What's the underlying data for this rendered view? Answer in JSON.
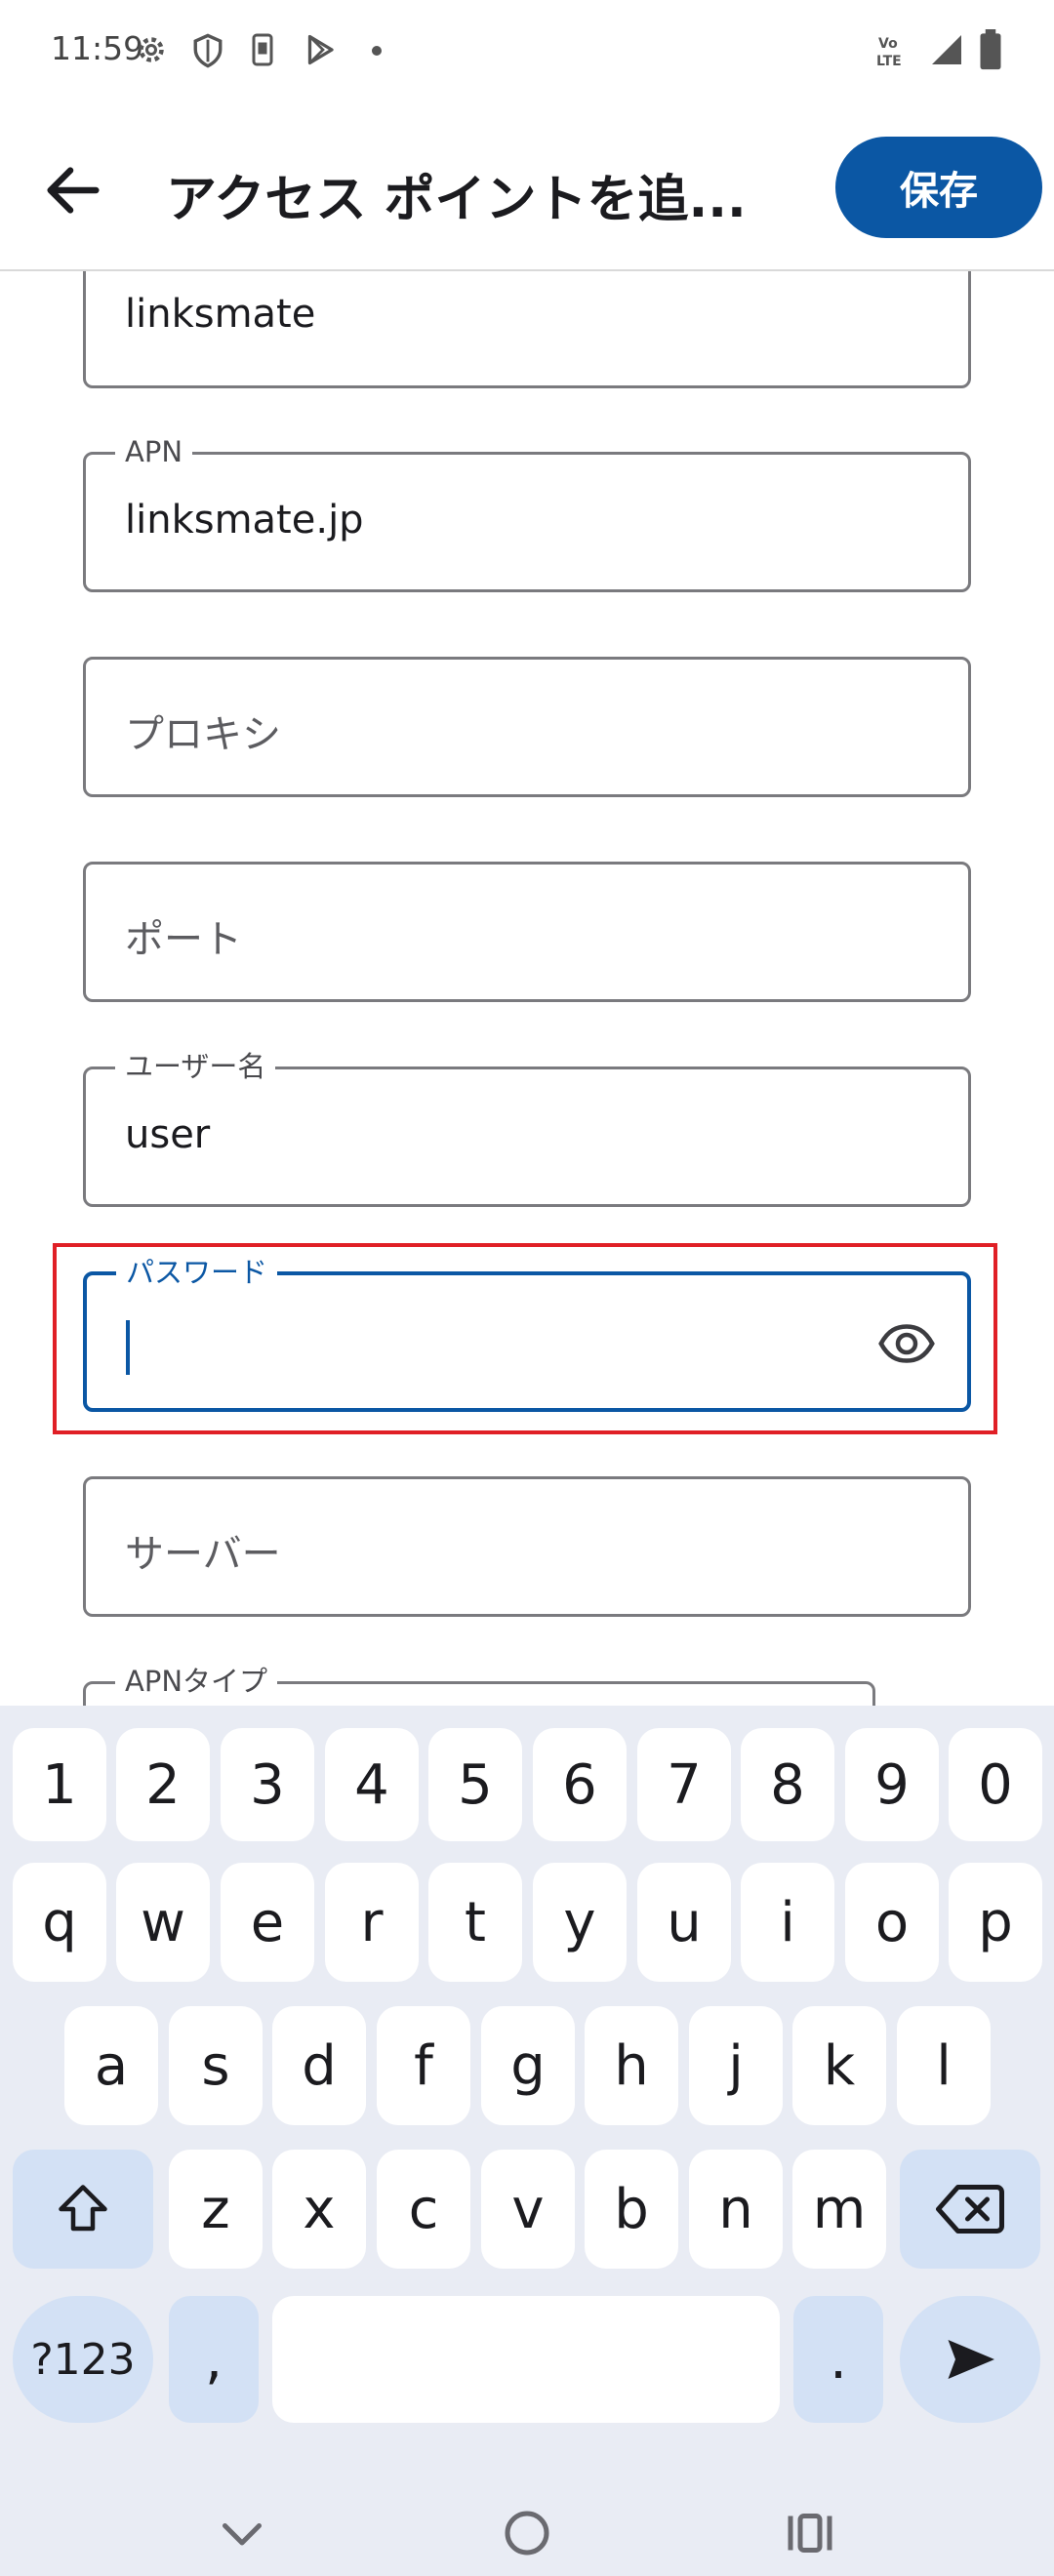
{
  "status_bar": {
    "time": "11:59",
    "icons": [
      "gear-icon",
      "shield-icon",
      "sim-icon",
      "play-store-icon",
      "dot-icon",
      "volte-icon",
      "signal-icon",
      "battery-icon"
    ],
    "volte_text": "Vo LTE"
  },
  "app_bar": {
    "title": "アクセス ポイントを追...",
    "save_label": "保存"
  },
  "form": {
    "name_value": "linksmate",
    "apn_label": "APN",
    "apn_value": "linksmate.jp",
    "proxy_placeholder": "プロキシ",
    "port_placeholder": "ポート",
    "username_label": "ユーザー名",
    "username_value": "user",
    "password_label": "パスワード",
    "password_value": "",
    "server_placeholder": "サーバー",
    "apn_type_label": "APNタイプ"
  },
  "keyboard": {
    "row_numbers": [
      "1",
      "2",
      "3",
      "4",
      "5",
      "6",
      "7",
      "8",
      "9",
      "0"
    ],
    "row_top": [
      "q",
      "w",
      "e",
      "r",
      "t",
      "y",
      "u",
      "i",
      "o",
      "p"
    ],
    "row_mid": [
      "a",
      "s",
      "d",
      "f",
      "g",
      "h",
      "j",
      "k",
      "l"
    ],
    "row_bot": [
      "z",
      "x",
      "c",
      "v",
      "b",
      "n",
      "m"
    ],
    "symbols_label": "?123",
    "comma_label": ",",
    "period_label": "."
  },
  "colors": {
    "accent": "#0b57a4",
    "highlight": "#e01f26",
    "keyboard_bg": "#e9ecf4",
    "modifier_key": "#d3e1f5"
  }
}
